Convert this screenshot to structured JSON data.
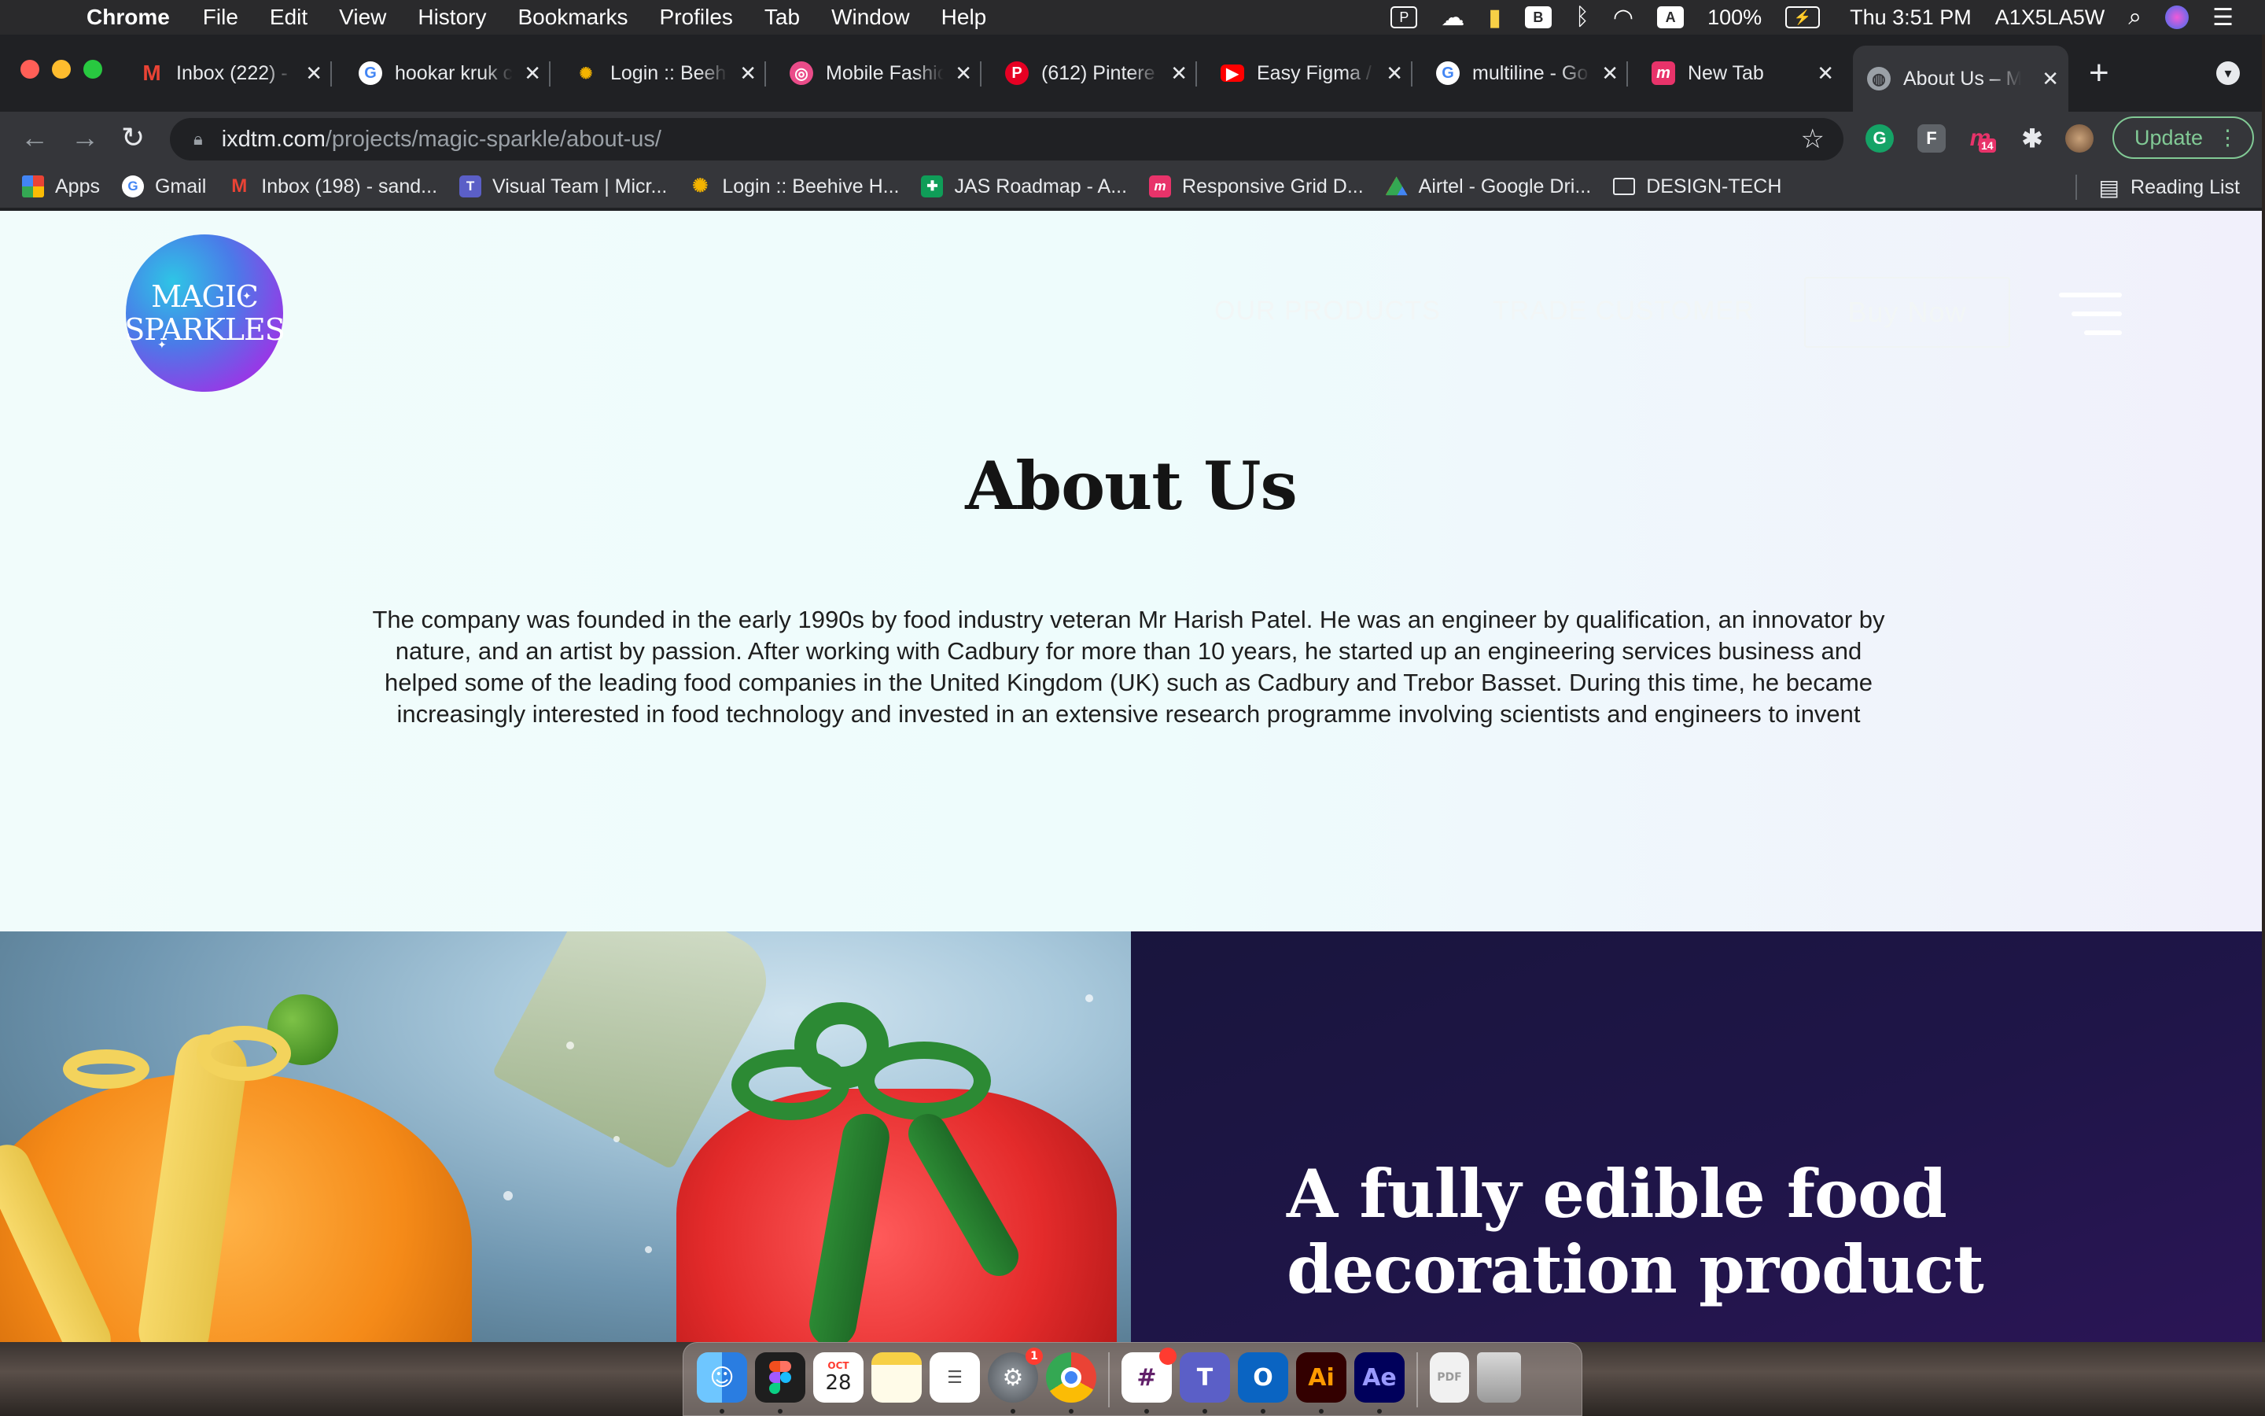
{
  "menubar": {
    "app_name": "Chrome",
    "menus": [
      "File",
      "Edit",
      "View",
      "History",
      "Bookmarks",
      "Profiles",
      "Tab",
      "Window",
      "Help"
    ],
    "battery": "100%",
    "clock": "Thu 3:51 PM",
    "user": "A1X5LA5W",
    "input_source": "A"
  },
  "tabs": [
    {
      "title": "Inbox (222) - ",
      "icon": "gmail-icon",
      "color": "#ea4335"
    },
    {
      "title": "hookar kruk c",
      "icon": "google-icon",
      "color": "#4285f4"
    },
    {
      "title": "Login :: Beeh",
      "icon": "bee-icon",
      "color": "#f4b400"
    },
    {
      "title": "Mobile Fashio",
      "icon": "dribbble-icon",
      "color": "#ea4c89"
    },
    {
      "title": "(612) Pintere",
      "icon": "pinterest-icon",
      "color": "#e60023"
    },
    {
      "title": "Easy Figma / ",
      "icon": "youtube-icon",
      "color": "#ff0000"
    },
    {
      "title": "multiline - Go",
      "icon": "google-icon",
      "color": "#4285f4"
    },
    {
      "title": "New Tab",
      "icon": "miro-icon",
      "color": "#e8336a"
    },
    {
      "title": "About Us – M",
      "icon": "globe-icon",
      "color": "#9aa0a6"
    }
  ],
  "address_bar": {
    "domain": "ixdtm.com",
    "path": "/projects/magic-sparkle/about-us/"
  },
  "toolbar": {
    "update_label": "Update",
    "extension_badge": "14"
  },
  "bookmarks": [
    {
      "label": "Apps",
      "icon": "apps-grid-icon"
    },
    {
      "label": "Gmail",
      "icon": "google-icon"
    },
    {
      "label": "Inbox (198) - sand...",
      "icon": "gmail-icon"
    },
    {
      "label": "Visual Team | Micr...",
      "icon": "teams-icon"
    },
    {
      "label": "Login :: Beehive H...",
      "icon": "bee-icon"
    },
    {
      "label": "JAS Roadmap - A...",
      "icon": "sheets-icon"
    },
    {
      "label": "Responsive Grid D...",
      "icon": "miro-icon"
    },
    {
      "label": "Airtel - Google Dri...",
      "icon": "drive-icon"
    },
    {
      "label": "DESIGN-TECH",
      "icon": "folder-icon"
    }
  ],
  "reading_list": "Reading List",
  "site": {
    "logo_line1": "MAGIC",
    "logo_line2": "SPARKLES",
    "nav": [
      "OUR PRODUCTS",
      "TRADE CUSTOMER"
    ],
    "buy_now": "Buy Now",
    "about_title": "About Us",
    "about_lines": [
      "The company was founded in the early 1990s by food industry veteran Mr Harish Patel. He was an engineer by qualification, an innovator by",
      "nature, and an artist by passion. After working with Cadbury for more than 10 years, he started up an engineering services business and",
      "helped some of the leading food companies in the United Kingdom (UK) such as Cadbury and Trebor Basset. During this time, he became",
      "increasingly interested in food technology and invested in an extensive research programme involving scientists and engineers to invent"
    ],
    "feature_heading_line1": "A fully edible food",
    "feature_heading_line2": "decoration product"
  },
  "dock": {
    "calendar_month": "OCT",
    "calendar_day": "28",
    "apps": [
      "finder-icon",
      "figma-icon",
      "calendar-icon",
      "notes-icon",
      "reminders-icon",
      "system-preferences-icon",
      "chrome-icon",
      "slack-icon",
      "teams-icon",
      "outlook-icon",
      "illustrator-icon",
      "after-effects-icon",
      "documents-icon",
      "trash-icon"
    ],
    "system_prefs_badge": "1"
  }
}
